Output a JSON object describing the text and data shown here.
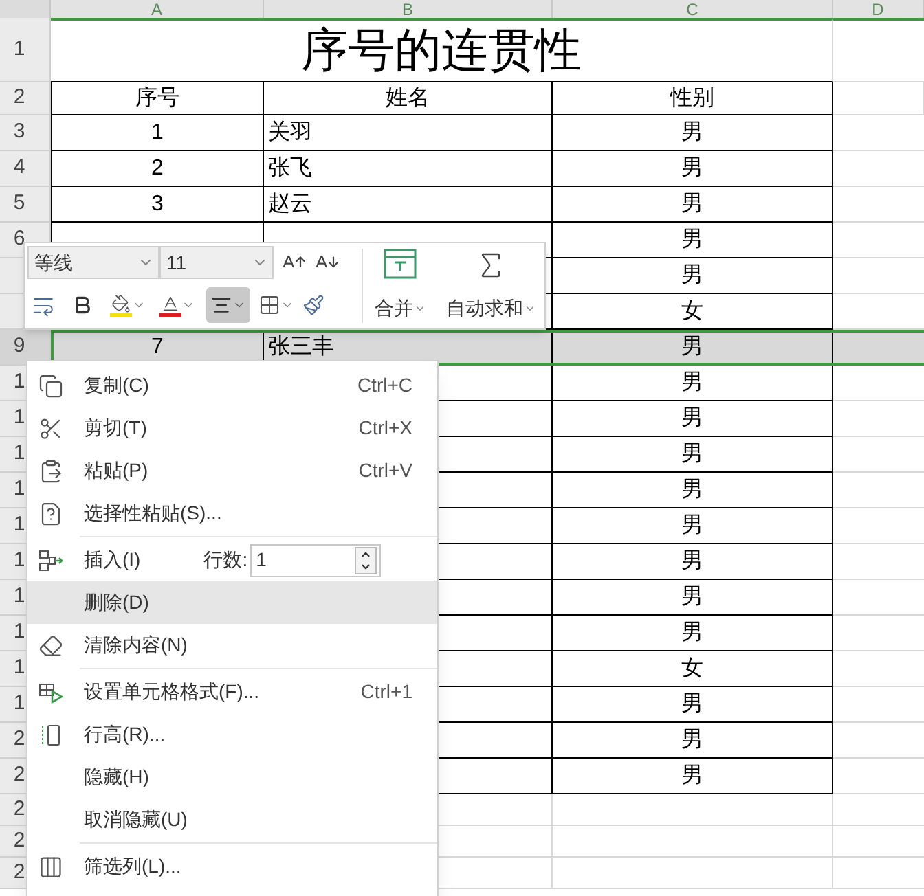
{
  "column_headers": [
    "A",
    "B",
    "C",
    "D"
  ],
  "title_row": {
    "number": "1",
    "title": "序号的连贯性"
  },
  "header_row": {
    "number": "2",
    "cells": [
      "序号",
      "姓名",
      "性别"
    ]
  },
  "rows": [
    {
      "number": "3",
      "seq": "1",
      "name": "关羽",
      "gender": "男",
      "selected": false
    },
    {
      "number": "4",
      "seq": "2",
      "name": "张飞",
      "gender": "男",
      "selected": false
    },
    {
      "number": "5",
      "seq": "3",
      "name": "赵云",
      "gender": "男",
      "selected": false
    },
    {
      "number": "6",
      "gender": "男",
      "selected": false
    },
    {
      "gender": "男",
      "selected": false
    },
    {
      "gender": "女",
      "selected": false
    },
    {
      "number": "9",
      "seq": "7",
      "name": "张三丰",
      "gender": "男",
      "selected": true
    },
    {
      "number": "1",
      "gender": "男",
      "selected": false
    },
    {
      "number": "1",
      "gender": "男",
      "selected": false
    },
    {
      "number": "1",
      "gender": "男",
      "selected": false
    },
    {
      "number": "1",
      "gender": "男",
      "selected": false
    },
    {
      "number": "1",
      "gender": "男",
      "selected": false
    },
    {
      "number": "1",
      "gender": "男",
      "selected": false
    },
    {
      "number": "1",
      "gender": "男",
      "selected": false
    },
    {
      "number": "1",
      "gender": "男",
      "selected": false
    },
    {
      "number": "1",
      "gender": "女",
      "selected": false
    },
    {
      "number": "1",
      "gender": "男",
      "selected": false
    },
    {
      "number": "2",
      "gender": "男",
      "selected": false
    },
    {
      "number": "2",
      "gender": "男",
      "selected": false
    }
  ],
  "empty_rows": [
    {
      "number": "2"
    },
    {
      "number": "2"
    },
    {
      "number": "2"
    }
  ],
  "mini_toolbar": {
    "font": "等线",
    "size": "11",
    "merge_label": "合并",
    "autosum_label": "自动求和",
    "align_active": true
  },
  "context_menu": {
    "items": [
      {
        "kind": "command",
        "label": "复制(C)",
        "shortcut": "Ctrl+C",
        "highlighted": false
      },
      {
        "kind": "command",
        "label": "剪切(T)",
        "shortcut": "Ctrl+X",
        "highlighted": false
      },
      {
        "kind": "command",
        "label": "粘贴(P)",
        "shortcut": "Ctrl+V",
        "highlighted": false
      },
      {
        "kind": "command",
        "label": "选择性粘贴(S)...",
        "highlighted": false
      },
      {
        "kind": "divider"
      },
      {
        "kind": "insert",
        "label": "插入(I)",
        "count_label": "行数:",
        "count_value": "1",
        "highlighted": false
      },
      {
        "kind": "command",
        "label": "删除(D)",
        "highlighted": true
      },
      {
        "kind": "command",
        "label": "清除内容(N)",
        "highlighted": false
      },
      {
        "kind": "divider"
      },
      {
        "kind": "command",
        "label": "设置单元格格式(F)...",
        "shortcut": "Ctrl+1",
        "highlighted": false
      },
      {
        "kind": "command",
        "label": "行高(R)...",
        "highlighted": false
      },
      {
        "kind": "command",
        "label": "隐藏(H)",
        "highlighted": false
      },
      {
        "kind": "command",
        "label": "取消隐藏(U)",
        "highlighted": false
      },
      {
        "kind": "divider"
      },
      {
        "kind": "command",
        "label": "筛选列(L)...",
        "highlighted": false
      }
    ]
  }
}
